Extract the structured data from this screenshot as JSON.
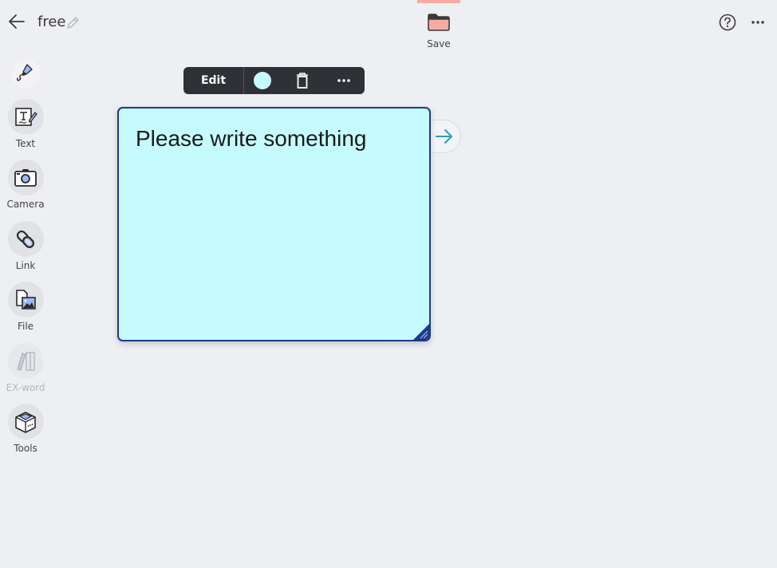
{
  "header": {
    "title": "free",
    "save_label": "Save",
    "icons": {
      "back": "arrow-left-icon",
      "edit_title": "pencil-icon",
      "save": "folder-icon",
      "help": "question-circle-icon",
      "more": "more-horizontal-icon"
    }
  },
  "sidebar": {
    "items": [
      {
        "label": "",
        "icon": "pen-icon"
      },
      {
        "label": "Text",
        "icon": "text-card-icon"
      },
      {
        "label": "Camera",
        "icon": "camera-icon"
      },
      {
        "label": "Link",
        "icon": "link-icon"
      },
      {
        "label": "File",
        "icon": "file-image-icon"
      },
      {
        "label": "EX-word",
        "icon": "books-icon",
        "disabled": true
      },
      {
        "label": "Tools",
        "icon": "toolbox-icon"
      }
    ]
  },
  "floating_toolbar": {
    "edit_label": "Edit",
    "color": "#c6fbfd"
  },
  "note": {
    "text": "Please write something",
    "background": "#c6fbfd",
    "border": "#1d3a8a"
  },
  "colors": {
    "save_accent": "#f7aaa2",
    "link_arrow": "#2e9bc4"
  }
}
